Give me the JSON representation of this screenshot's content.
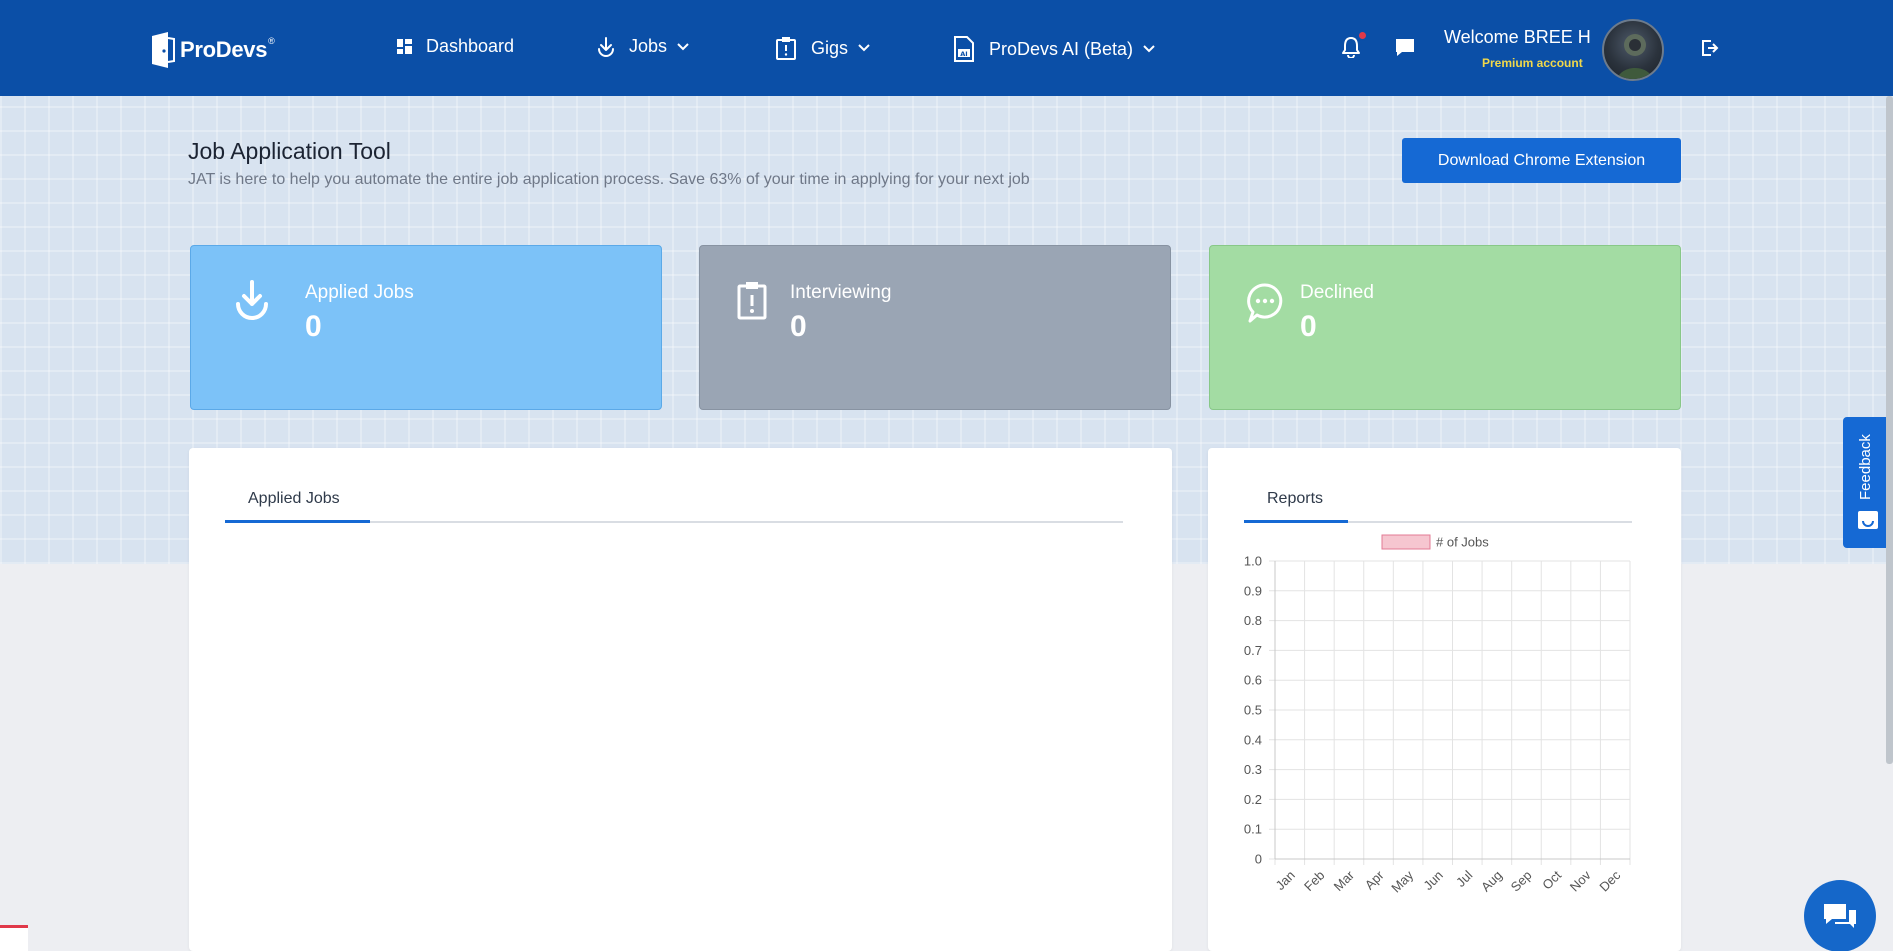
{
  "header": {
    "logo_text": "ProDevs",
    "logo_reg": "®",
    "nav": [
      {
        "label": "Dashboard",
        "icon": "dashboard-icon"
      },
      {
        "label": "Jobs",
        "icon": "download-icon",
        "has_dropdown": true
      },
      {
        "label": "Gigs",
        "icon": "clipboard-icon",
        "has_dropdown": true
      },
      {
        "label": "ProDevs AI (Beta)",
        "icon": "ai-document-icon",
        "has_dropdown": true
      }
    ],
    "welcome": "Welcome BREE H",
    "account_type": "Premium account",
    "icons": [
      "bell-icon",
      "chat-icon",
      "logout-icon"
    ]
  },
  "page": {
    "title": "Job Application Tool",
    "subtitle": "JAT is here to help you automate the entire job application process. Save 63% of your time in applying for your next job",
    "download_button": "Download Chrome Extension"
  },
  "stats": [
    {
      "label": "Applied Jobs",
      "value": "0",
      "color": "#7cc2f8",
      "icon": "download-icon"
    },
    {
      "label": "Interviewing",
      "value": "0",
      "color": "#9aa5b4",
      "icon": "clipboard-alert-icon"
    },
    {
      "label": "Declined",
      "value": "0",
      "color": "#a3dca3",
      "icon": "speech-bubble-icon"
    }
  ],
  "applied_card": {
    "tab": "Applied Jobs"
  },
  "reports_card": {
    "tab": "Reports"
  },
  "chart_data": {
    "type": "bar",
    "categories": [
      "Jan",
      "Feb",
      "Mar",
      "Apr",
      "May",
      "Jun",
      "Jul",
      "Aug",
      "Sep",
      "Oct",
      "Nov",
      "Dec"
    ],
    "series": [
      {
        "name": "# of Jobs",
        "values": [
          0,
          0,
          0,
          0,
          0,
          0,
          0,
          0,
          0,
          0,
          0,
          0
        ],
        "color": "#f6c6d0"
      }
    ],
    "yticks": [
      "0",
      "0.1",
      "0.2",
      "0.3",
      "0.4",
      "0.5",
      "0.6",
      "0.7",
      "0.8",
      "0.9",
      "1.0"
    ],
    "ylim": [
      0,
      1
    ],
    "grid": true,
    "legend_position": "top"
  },
  "feedback": {
    "label": "Feedback"
  },
  "colors": {
    "header": "#0b4fa7",
    "primary": "#1569d4",
    "premium": "#f1d84a"
  }
}
